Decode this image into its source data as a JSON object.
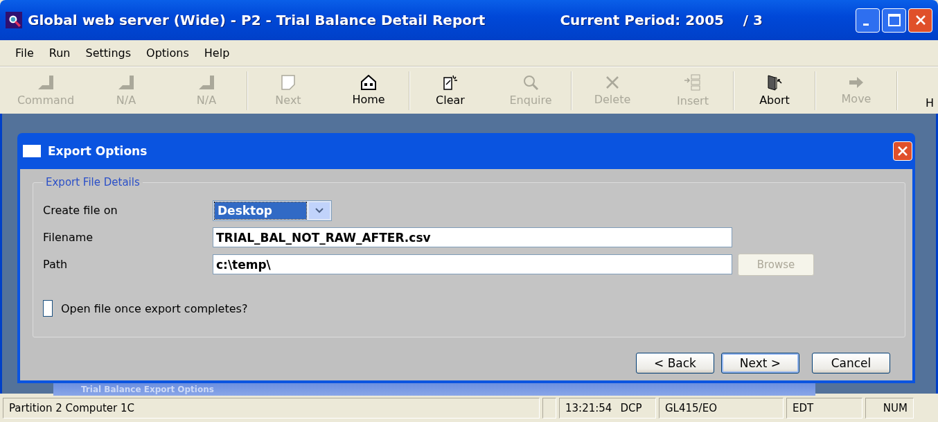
{
  "window": {
    "title": "Global web server (Wide) - P2 - Trial Balance Detail Report",
    "period": "Current Period: 2005    / 3"
  },
  "menu": [
    "File",
    "Run",
    "Settings",
    "Options",
    "Help"
  ],
  "toolbar": [
    {
      "label": "Command",
      "disabled": true
    },
    {
      "label": "N/A",
      "disabled": true
    },
    {
      "label": "N/A",
      "disabled": true
    },
    {
      "label": "Next",
      "disabled": true
    },
    {
      "label": "Home",
      "disabled": false
    },
    {
      "label": "Clear",
      "disabled": false
    },
    {
      "label": "Enquire",
      "disabled": true
    },
    {
      "label": "Delete",
      "disabled": true
    },
    {
      "label": "Insert",
      "disabled": true
    },
    {
      "label": "Abort",
      "disabled": false
    },
    {
      "label": "Move",
      "disabled": true
    },
    {
      "label": "H",
      "disabled": false
    }
  ],
  "dialog": {
    "title": "Export Options",
    "group": "Export File Details",
    "create_on": {
      "label": "Create file on",
      "value": "Desktop"
    },
    "filename": {
      "label": "Filename",
      "value": "TRIAL_BAL_NOT_RAW_AFTER.csv"
    },
    "path": {
      "label": "Path",
      "value": "c:\\temp\\",
      "browse": {
        "label": "Browse",
        "disabled": true
      }
    },
    "open_file": {
      "label": "Open file once export completes?",
      "checked": false
    },
    "buttons": [
      {
        "label": "< Back",
        "focused": false
      },
      {
        "label": "Next >",
        "focused": true
      },
      {
        "label": "Cancel",
        "focused": false
      }
    ]
  },
  "background_dialog": {
    "title": "Trial Balance Export Options"
  },
  "status_bar": [
    "Partition 2 Computer 1C",
    "13:21:54",
    "DCP",
    "GL415/EO",
    "EDT",
    "NUM"
  ]
}
